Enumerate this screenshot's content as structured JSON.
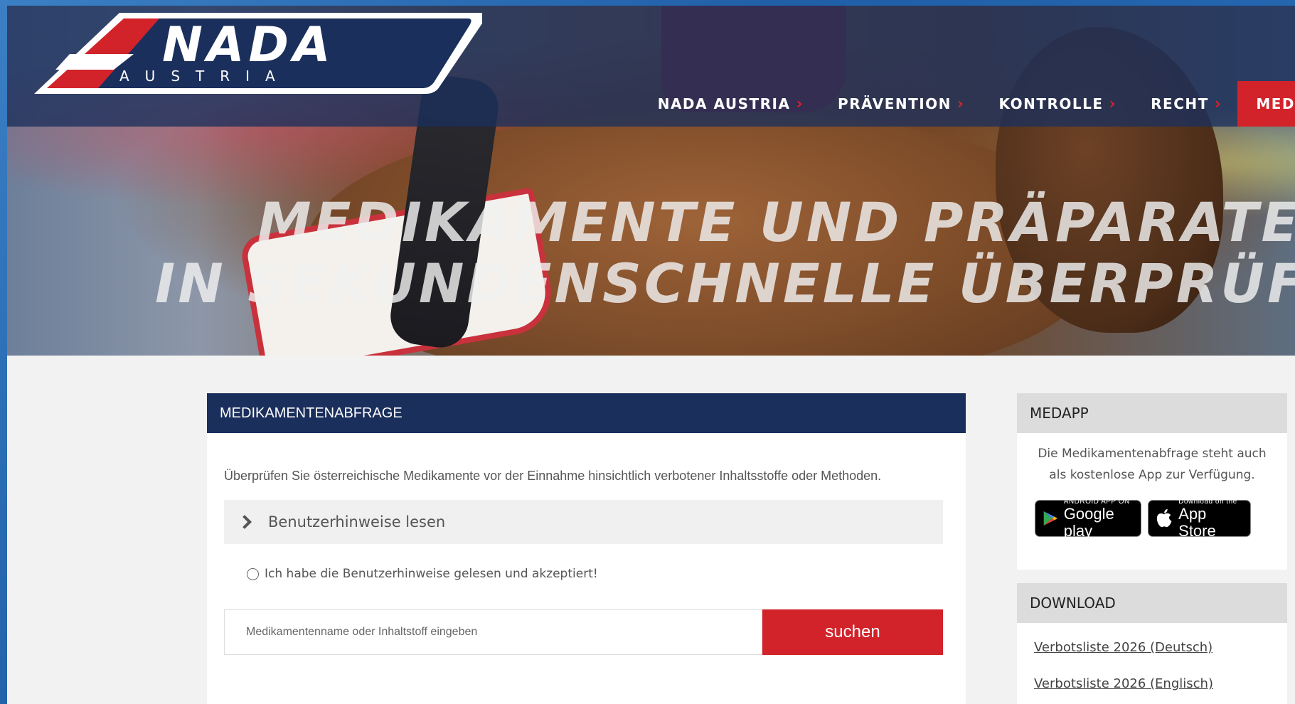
{
  "header": {
    "logo_main": "NADA",
    "logo_sub": "AUSTRIA",
    "nav": [
      {
        "label": "NADA AUSTRIA"
      },
      {
        "label": "PRÄVENTION"
      },
      {
        "label": "KONTROLLE"
      },
      {
        "label": "RECHT"
      },
      {
        "label": "MED"
      }
    ]
  },
  "hero": {
    "line1": "MEDIKAMENTE UND PRÄPARATE",
    "line2": "IN SEKUNDENSCHNELLE ÜBERPRÜFEN"
  },
  "main": {
    "title": "MEDIKAMENTENABFRAGE",
    "intro": "Überprüfen Sie österreichische Medikamente vor der Einnahme hinsichtlich verbotener Inhaltsstoffe oder Methoden.",
    "accordion_label": "Benutzerhinweise lesen",
    "accept_label": "Ich habe die Benutzerhinweise gelesen und akzeptiert!",
    "search_placeholder": "Medikamentenname oder Inhaltstoff eingeben",
    "search_button": "suchen"
  },
  "sidebar": {
    "medapp": {
      "title": "MEDAPP",
      "text": "Die Medikamentenabfrage steht auch als kostenlose App zur Verfügung.",
      "google_small": "ANDROID APP ON",
      "google_big": "Google play",
      "apple_small": "Download on the",
      "apple_big": "App Store"
    },
    "download": {
      "title": "DOWNLOAD",
      "links": [
        {
          "label": "Verbotsliste 2026 (Deutsch)"
        },
        {
          "label": "Verbotsliste 2026 (Englisch)"
        }
      ]
    }
  },
  "colors": {
    "navy": "#1b2f5c",
    "red": "#d2232a"
  }
}
